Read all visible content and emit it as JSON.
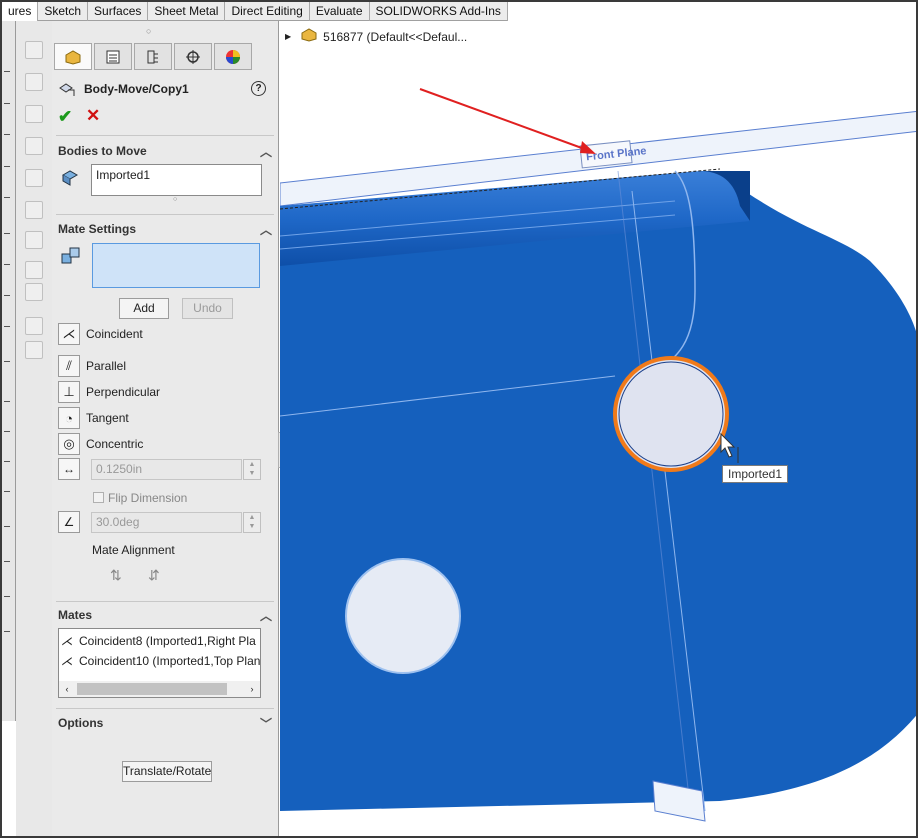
{
  "command_tabs": [
    "ures",
    "Sketch",
    "Surfaces",
    "Sheet Metal",
    "Direct Editing",
    "Evaluate",
    "SOLIDWORKS Add-Ins"
  ],
  "feature_tree": {
    "node_label": "516877  (Default<<Defaul..."
  },
  "property_manager": {
    "title": "Body-Move/Copy1",
    "help_label": "?",
    "bodies_section": {
      "header": "Bodies to Move",
      "selection": "Imported1"
    },
    "mate_settings": {
      "header": "Mate Settings",
      "add_label": "Add",
      "undo_label": "Undo",
      "mates": [
        "Coincident",
        "Parallel",
        "Perpendicular",
        "Tangent",
        "Concentric"
      ],
      "distance_value": "0.1250in",
      "flip_dimension_label": "Flip Dimension",
      "angle_value": "30.0deg",
      "mate_alignment_label": "Mate Alignment"
    },
    "mates_section": {
      "header": "Mates",
      "items": [
        "Coincident8 (Imported1,Right Pla",
        "Coincident10 (Imported1,Top Plan"
      ]
    },
    "options_section": {
      "header": "Options"
    },
    "translate_rotate_label": "Translate/Rotate"
  },
  "viewport": {
    "plane_label": "Front Plane",
    "tooltip": "Imported1",
    "part_color": "#1560bd",
    "highlight_color": "#f07a1a",
    "arrow_color": "#e02020"
  }
}
